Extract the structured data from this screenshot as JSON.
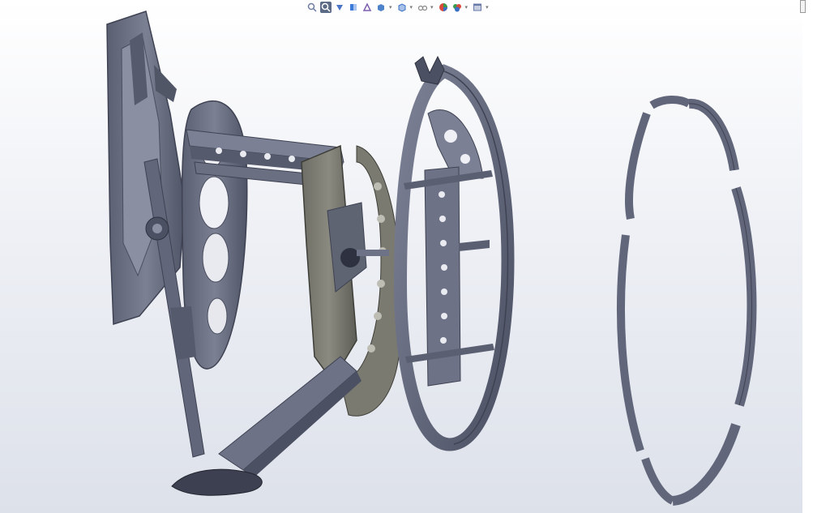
{
  "viewport": {
    "background_top": "#ffffff",
    "background_bottom": "#dde1ea",
    "part_color": "#6d7286",
    "part_shadow": "#474c5e",
    "part_highlight": "#9fa4b6"
  },
  "toolbar": {
    "items": [
      {
        "icon": "zoom-to-fit-icon",
        "color": "#6f7da3",
        "active": false
      },
      {
        "icon": "zoom-to-area-icon",
        "color": "#ffffff",
        "active": true
      },
      {
        "icon": "previous-view-icon",
        "color": "#4b74c8",
        "active": false
      },
      {
        "icon": "section-view-icon",
        "color": "#3d7bd8",
        "active": false
      },
      {
        "icon": "dynamic-annotation-icon",
        "color": "#7d5fb0",
        "active": false
      },
      {
        "icon": "view-orientation-icon",
        "color": "#4f83c9",
        "active": false,
        "dropdown": true
      },
      {
        "icon": "display-style-icon",
        "color": "#3a6fc4",
        "active": false,
        "dropdown": true
      },
      {
        "icon": "hide-show-items-icon",
        "color": "#888888",
        "active": false,
        "dropdown": true
      },
      {
        "icon": "edit-appearance-icon",
        "color": "#d94a3a",
        "active": false
      },
      {
        "icon": "apply-scene-icon",
        "color": "#3c9a4c",
        "active": false,
        "dropdown": true
      },
      {
        "icon": "view-settings-icon",
        "color": "#6a7aa8",
        "active": false,
        "dropdown": true
      }
    ]
  }
}
